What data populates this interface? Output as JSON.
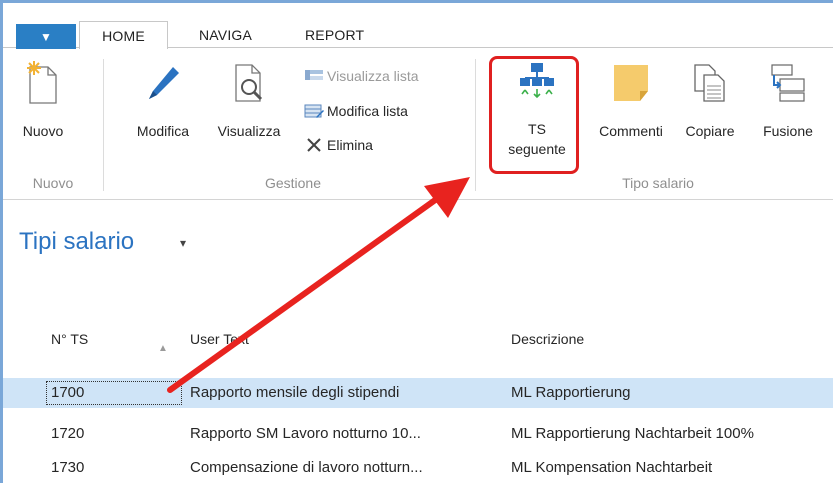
{
  "tabs": {
    "app_menu": "▼",
    "home": "HOME",
    "naviga": "NAVIGA",
    "report": "REPORT"
  },
  "ribbon": {
    "nuovo": "Nuovo",
    "modifica": "Modifica",
    "visualizza": "Visualizza",
    "visualizza_lista": "Visualizza lista",
    "modifica_lista": "Modifica lista",
    "elimina": "Elimina",
    "ts_line1": "TS",
    "ts_line2": "seguente",
    "commenti": "Commenti",
    "copiare": "Copiare",
    "fusione": "Fusione",
    "groups": {
      "nuovo": "Nuovo",
      "gestione": "Gestione",
      "tipo_salario": "Tipo salario"
    }
  },
  "page": {
    "title": "Tipi salario",
    "title_chevron": "▾"
  },
  "table": {
    "headers": [
      "N° TS",
      "User Text",
      "Descrizione"
    ],
    "rows": [
      {
        "n": "1700",
        "user_text": "Rapporto mensile degli stipendi",
        "descrizione": "ML Rapportierung"
      },
      {
        "n": "1720",
        "user_text": "Rapporto SM Lavoro notturno 10...",
        "descrizione": "ML Rapportierung Nachtarbeit 100%"
      },
      {
        "n": "1730",
        "user_text": "Compensazione di lavoro notturn...",
        "descrizione": "ML Kompensation Nachtarbeit"
      }
    ]
  },
  "colors": {
    "accent": "#2b73c1",
    "selection": "#cfe4f7",
    "annotation": "#e02020"
  },
  "icons": [
    "new-document-icon",
    "pencil-icon",
    "view-document-icon",
    "list-view-icon",
    "edit-list-icon",
    "close-x-icon",
    "hierarchy-icon",
    "sticky-note-icon",
    "copy-icon",
    "merge-icon"
  ]
}
